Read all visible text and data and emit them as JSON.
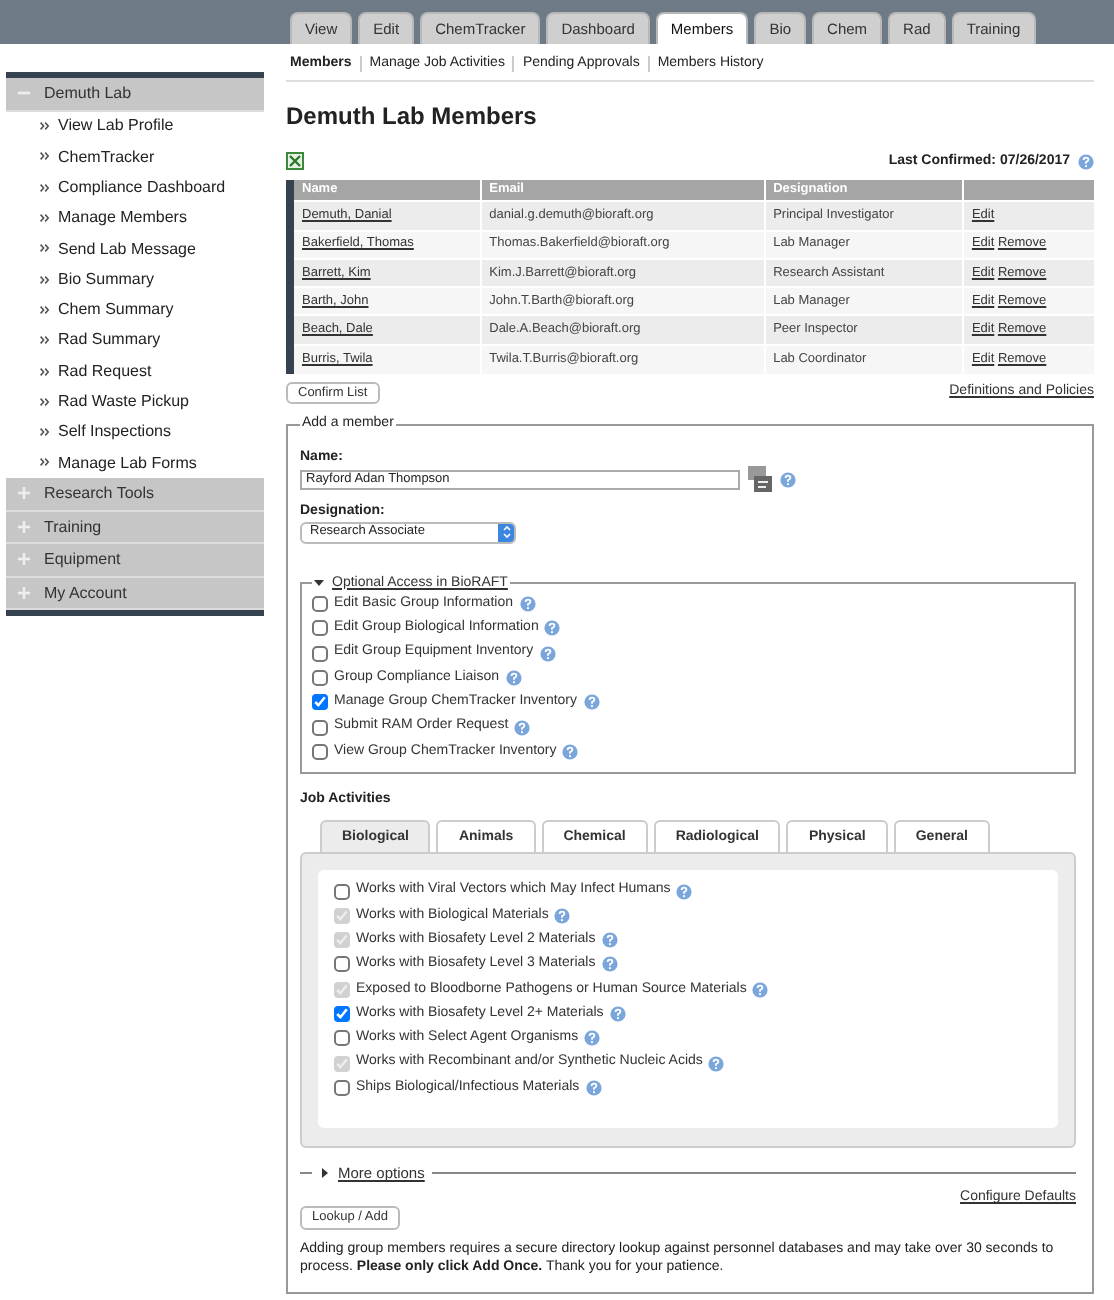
{
  "top_tabs": [
    {
      "label": "View",
      "selected": false
    },
    {
      "label": "Edit",
      "selected": false
    },
    {
      "label": "ChemTracker",
      "selected": false
    },
    {
      "label": "Dashboard",
      "selected": false
    },
    {
      "label": "Members",
      "selected": true
    },
    {
      "label": "Bio",
      "selected": false
    },
    {
      "label": "Chem",
      "selected": false
    },
    {
      "label": "Rad",
      "selected": false
    },
    {
      "label": "Training",
      "selected": false
    }
  ],
  "sidebar": {
    "sections": [
      {
        "label": "Demuth Lab",
        "expanded": true,
        "children": [
          {
            "label": "View Lab Profile"
          },
          {
            "label": "ChemTracker"
          },
          {
            "label": "Compliance Dashboard"
          },
          {
            "label": "Manage Members"
          },
          {
            "label": "Send Lab Message"
          },
          {
            "label": "Bio Summary"
          },
          {
            "label": "Chem Summary"
          },
          {
            "label": "Rad Summary"
          },
          {
            "label": "Rad Request"
          },
          {
            "label": "Rad Waste Pickup"
          },
          {
            "label": "Self Inspections"
          },
          {
            "label": "Manage Lab Forms"
          }
        ]
      },
      {
        "label": "Research Tools",
        "expanded": false
      },
      {
        "label": "Training",
        "expanded": false
      },
      {
        "label": "Equipment",
        "expanded": false
      },
      {
        "label": "My Account",
        "expanded": false
      }
    ]
  },
  "sub_nav": [
    {
      "label": "Members",
      "selected": true
    },
    {
      "label": "Manage Job Activities",
      "selected": false
    },
    {
      "label": "Pending Approvals",
      "selected": false
    },
    {
      "label": "Members History",
      "selected": false
    }
  ],
  "page_title": "Demuth Lab Members",
  "last_confirmed": "Last Confirmed: 07/26/2017",
  "members_table": {
    "columns": [
      "Name",
      "Email",
      "Designation"
    ],
    "rows": [
      {
        "name": "Demuth, Danial",
        "email": "danial.g.demuth@bioraft.org",
        "designation": "Principal Investigator",
        "actions": [
          "Edit"
        ]
      },
      {
        "name": "Bakerfield, Thomas",
        "email": "Thomas.Bakerfield@bioraft.org",
        "designation": "Lab Manager",
        "actions": [
          "Edit",
          "Remove"
        ]
      },
      {
        "name": "Barrett, Kim",
        "email": "Kim.J.Barrett@bioraft.org",
        "designation": "Research Assistant",
        "actions": [
          "Edit",
          "Remove"
        ]
      },
      {
        "name": "Barth, John",
        "email": "John.T.Barth@bioraft.org",
        "designation": "Lab Manager",
        "actions": [
          "Edit",
          "Remove"
        ]
      },
      {
        "name": "Beach, Dale",
        "email": "Dale.A.Beach@bioraft.org",
        "designation": "Peer Inspector",
        "actions": [
          "Edit",
          "Remove"
        ]
      },
      {
        "name": "Burris, Twila",
        "email": "Twila.T.Burris@bioraft.org",
        "designation": "Lab Coordinator",
        "actions": [
          "Edit",
          "Remove"
        ]
      }
    ]
  },
  "confirm_button": "Confirm List",
  "definitions_link": "Definitions and Policies",
  "add_member": {
    "legend": "Add a member",
    "name_label": "Name:",
    "name_value": "Rayford Adan Thompson",
    "designation_label": "Designation:",
    "designation_value": "Research Associate",
    "optional_access": {
      "label": "Optional Access in BioRAFT",
      "expanded": true,
      "items": [
        {
          "label": "Edit Basic Group Information",
          "checked": false
        },
        {
          "label": "Edit Group Biological Information",
          "checked": false
        },
        {
          "label": "Edit Group Equipment Inventory",
          "checked": false
        },
        {
          "label": "Group Compliance Liaison",
          "checked": false
        },
        {
          "label": "Manage Group ChemTracker Inventory",
          "checked": true
        },
        {
          "label": "Submit RAM Order Request",
          "checked": false
        },
        {
          "label": "View Group ChemTracker Inventory",
          "checked": false
        }
      ]
    },
    "job_activities": {
      "label": "Job Activities",
      "tabs": [
        {
          "label": "Biological",
          "selected": true
        },
        {
          "label": "Animals",
          "selected": false
        },
        {
          "label": "Chemical",
          "selected": false
        },
        {
          "label": "Radiological",
          "selected": false
        },
        {
          "label": "Physical",
          "selected": false
        },
        {
          "label": "General",
          "selected": false
        }
      ],
      "items": [
        {
          "label": "Works with Viral Vectors which May Infect Humans",
          "checked": false,
          "disabled": false
        },
        {
          "label": "Works with Biological Materials",
          "checked": true,
          "disabled": true
        },
        {
          "label": "Works with Biosafety Level 2 Materials",
          "checked": true,
          "disabled": true
        },
        {
          "label": "Works with Biosafety Level 3 Materials",
          "checked": false,
          "disabled": false
        },
        {
          "label": "Exposed to Bloodborne Pathogens or Human Source Materials",
          "checked": true,
          "disabled": true
        },
        {
          "label": "Works with Biosafety Level 2+ Materials",
          "checked": true,
          "disabled": false
        },
        {
          "label": "Works with Select Agent Organisms",
          "checked": false,
          "disabled": false
        },
        {
          "label": "Works with Recombinant and/or Synthetic Nucleic Acids",
          "checked": true,
          "disabled": true
        },
        {
          "label": "Ships Biological/Infectious Materials",
          "checked": false,
          "disabled": false
        }
      ]
    },
    "more_options": {
      "label": "More options",
      "expanded": false
    },
    "configure_defaults": "Configure Defaults",
    "lookup_button": "Lookup / Add",
    "note": "Adding group members requires a secure directory lookup against personnel databases and may take over 30 seconds to process. **Please only click Add Once.** Thank you for your patience."
  }
}
